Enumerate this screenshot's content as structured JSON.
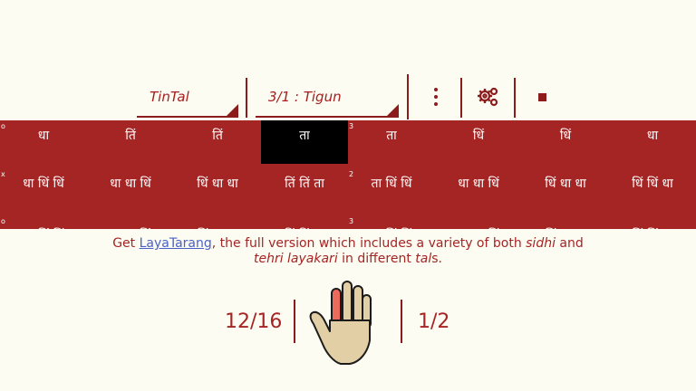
{
  "toolbar": {
    "tal_select": "TinTal",
    "laya_select": "3/1 : Tigun",
    "more_icon": "kebab-menu-icon",
    "settings_icon": "gears-icon",
    "stop_icon": "stop-icon"
  },
  "grid": {
    "rows": [
      {
        "start_marker": "o",
        "mid_marker": "3",
        "cells": [
          "धा",
          "तिं",
          "तिं",
          "ता",
          "ता",
          "धिं",
          "धिं",
          "धा"
        ]
      },
      {
        "start_marker": "x",
        "mid_marker": "2",
        "cells": [
          "धा धिं धिं",
          "धा धा धिं",
          "धिं धा धा",
          "तिं तिं ता",
          "ता धिं धिं",
          "धा धा धिं",
          "धिं धा धा",
          "धिं धिं धा"
        ]
      },
      {
        "start_marker": "o",
        "mid_marker": "3",
        "cells": [
          "धा धिं धिं",
          "ता ता धिं",
          "धिं धा ता",
          "तिं तिं धा",
          "ता धिं धिं",
          "धा धा धिं",
          "धिं ता धा",
          "धिं धिं धा"
        ]
      }
    ],
    "active_cell": "ता",
    "colors": {
      "band": "#a52424",
      "active": "#000000",
      "text": "#ffffff"
    }
  },
  "promo": {
    "get": "Get ",
    "link": "LayaTarang",
    "rest1": ", the full version which includes a variety of both ",
    "sidhi": "sidhi",
    "and": " and",
    "tehri": "tehri layakari",
    "in_diff": " in different ",
    "tal": "tal",
    "s": "s."
  },
  "counter": {
    "left": "12/16",
    "right": "1/2"
  },
  "hand_icon": "hand-icon",
  "accent": "#a52424"
}
